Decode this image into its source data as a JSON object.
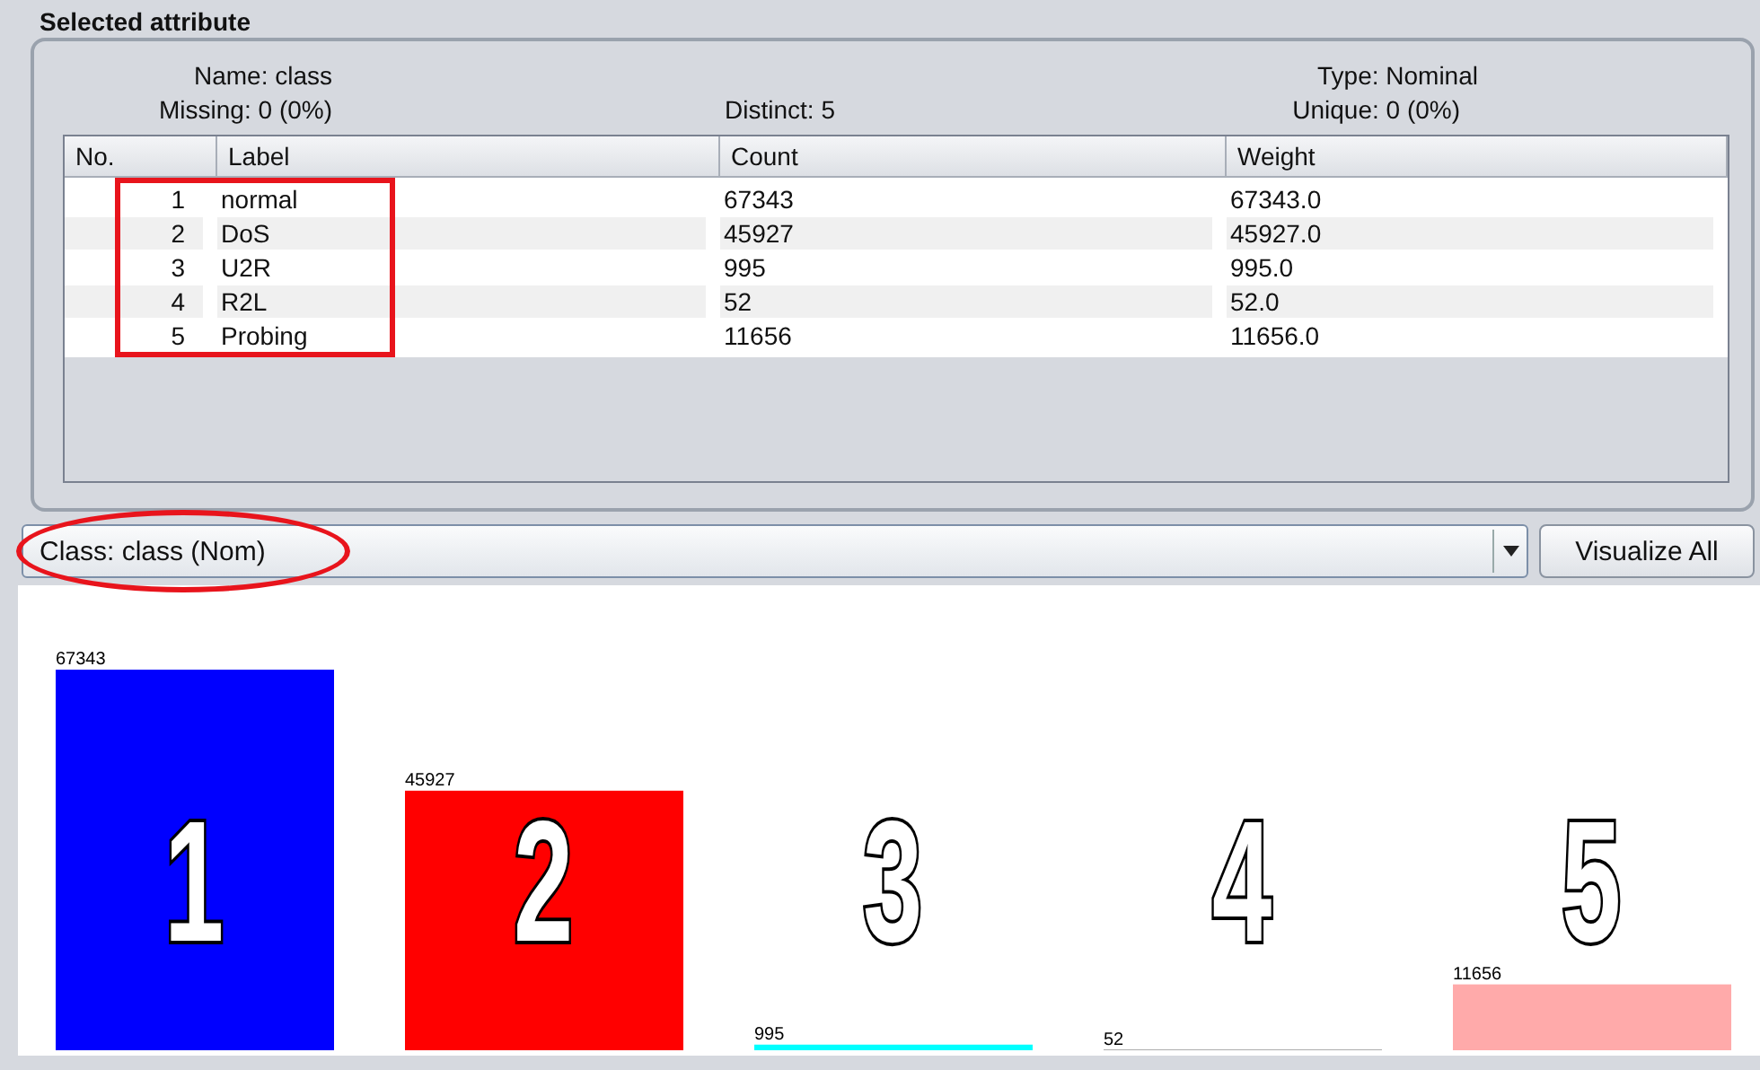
{
  "section_title": "Selected attribute",
  "attribute": {
    "name_label": "Name:",
    "name": "class",
    "type_label": "Type:",
    "type": "Nominal",
    "missing_label": "Missing:",
    "missing": "0 (0%)",
    "distinct_label": "Distinct:",
    "distinct": "5",
    "unique_label": "Unique:",
    "unique": "0 (0%)"
  },
  "table": {
    "columns": [
      "No.",
      "Label",
      "Count",
      "Weight"
    ],
    "rows": [
      [
        "1",
        "normal",
        "67343",
        "67343.0"
      ],
      [
        "2",
        "DoS",
        "45927",
        "45927.0"
      ],
      [
        "3",
        "U2R",
        "995",
        "995.0"
      ],
      [
        "4",
        "R2L",
        "52",
        "52.0"
      ],
      [
        "5",
        "Probing",
        "11656",
        "11656.0"
      ]
    ]
  },
  "class_selector": {
    "value": "Class: class (Nom)"
  },
  "visualize_button": "Visualize All",
  "chart_data": {
    "type": "bar",
    "categories": [
      "1",
      "2",
      "3",
      "4",
      "5"
    ],
    "values": [
      67343,
      45927,
      995,
      52,
      11656
    ],
    "colors": [
      "#0000ff",
      "#ff0000",
      "#00ffff",
      "#000000",
      "#ffaaaa"
    ],
    "data_labels": true
  }
}
